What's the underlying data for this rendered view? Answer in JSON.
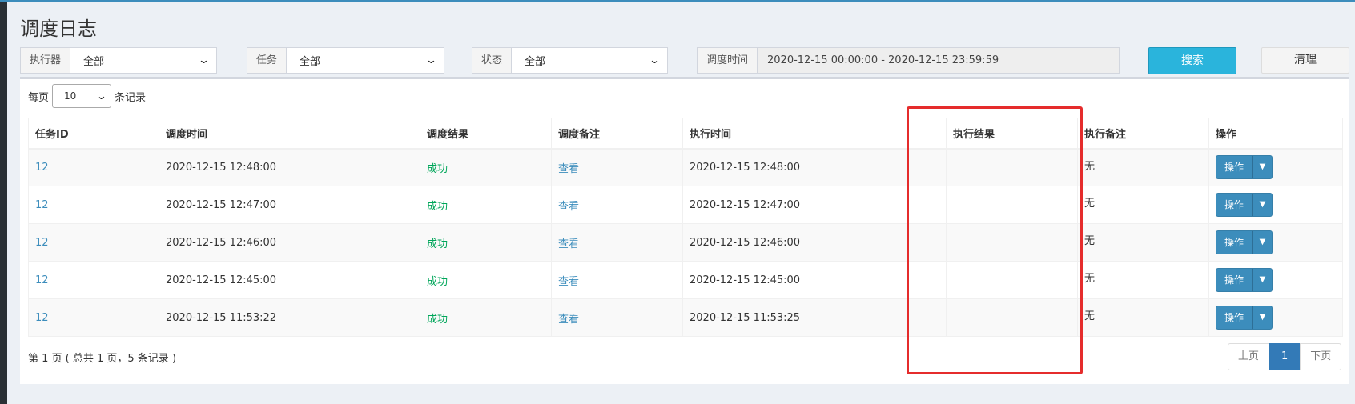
{
  "header": {
    "title": "调度日志"
  },
  "filters": {
    "executor": {
      "label": "执行器",
      "value": "全部"
    },
    "job": {
      "label": "任务",
      "value": "全部"
    },
    "status": {
      "label": "状态",
      "value": "全部"
    },
    "time": {
      "label": "调度时间",
      "value": "2020-12-15 00:00:00 - 2020-12-15 23:59:59"
    }
  },
  "buttons": {
    "search": "搜索",
    "clear": "清理"
  },
  "page_length": {
    "prefix": "每页",
    "value": "10",
    "suffix": "条记录"
  },
  "table": {
    "headers": [
      "任务ID",
      "调度时间",
      "调度结果",
      "调度备注",
      "执行时间",
      "",
      "执行结果",
      "执行备注",
      "操作"
    ],
    "rows": [
      {
        "id": "12",
        "trigger_time": "2020-12-15 12:48:00",
        "trigger_result": "成功",
        "trigger_note": "查看",
        "handle_time": "2020-12-15 12:48:00",
        "handle_result": "",
        "handle_note": "无",
        "action": "操作"
      },
      {
        "id": "12",
        "trigger_time": "2020-12-15 12:47:00",
        "trigger_result": "成功",
        "trigger_note": "查看",
        "handle_time": "2020-12-15 12:47:00",
        "handle_result": "",
        "handle_note": "无",
        "action": "操作"
      },
      {
        "id": "12",
        "trigger_time": "2020-12-15 12:46:00",
        "trigger_result": "成功",
        "trigger_note": "查看",
        "handle_time": "2020-12-15 12:46:00",
        "handle_result": "",
        "handle_note": "无",
        "action": "操作"
      },
      {
        "id": "12",
        "trigger_time": "2020-12-15 12:45:00",
        "trigger_result": "成功",
        "trigger_note": "查看",
        "handle_time": "2020-12-15 12:45:00",
        "handle_result": "",
        "handle_note": "无",
        "action": "操作"
      },
      {
        "id": "12",
        "trigger_time": "2020-12-15 11:53:22",
        "trigger_result": "成功",
        "trigger_note": "查看",
        "handle_time": "2020-12-15 11:53:25",
        "handle_result": "",
        "handle_note": "无",
        "action": "操作"
      }
    ]
  },
  "footer": {
    "info": "第 1 页 ( 总共 1 页，5 条记录 )"
  },
  "pagination": {
    "prev": "上页",
    "current": "1",
    "next": "下页"
  },
  "icons": {
    "dropdown": "chevron-down-icon",
    "caret": "caret-down-icon"
  },
  "colors": {
    "primary": "#3c8dbc",
    "search": "#2ab4dc",
    "success": "#00a65a",
    "highlight": "#e52c2c"
  }
}
